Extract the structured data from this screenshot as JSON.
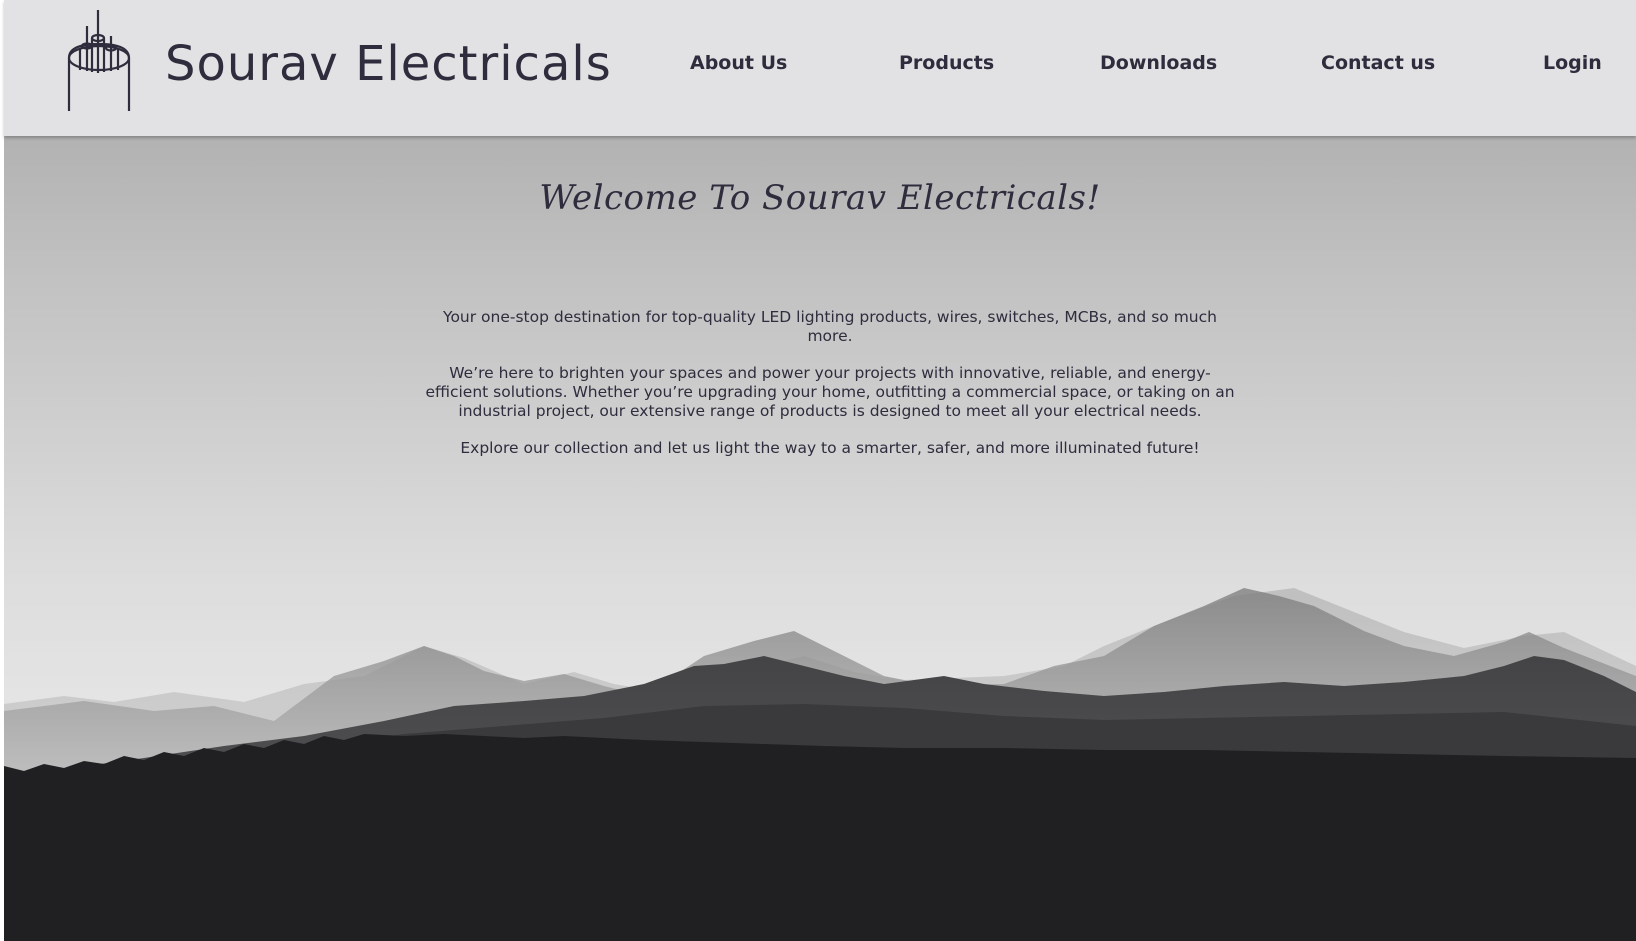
{
  "header": {
    "brand": "Sourav Electricals",
    "logo_icon": "cable-wires-icon",
    "nav": [
      {
        "label": "About Us"
      },
      {
        "label": "Products"
      },
      {
        "label": "Downloads"
      },
      {
        "label": "Contact us"
      },
      {
        "label": "Login"
      }
    ]
  },
  "hero": {
    "title": "Welcome To Sourav Electricals!",
    "paragraphs": [
      "Your one-stop destination for top-quality LED lighting products, wires, switches, MCBs, and so much more.",
      "We’re here to brighten your spaces and power your projects with innovative, reliable, and energy-efficient solutions. Whether you’re upgrading your home, outfitting a commercial space, or taking on an industrial project, our extensive range of products is designed to meet all your electrical needs.",
      "Explore our collection and let us light the way to a smarter, safer, and more illuminated future!"
    ],
    "background": "mountain-landscape"
  },
  "colors": {
    "text": "#2f2c3d",
    "header_bg": "#e2e1e3",
    "sky_top": "#b2b2b2",
    "sky_bottom": "#e6e6e6",
    "foreground": "#202023"
  }
}
